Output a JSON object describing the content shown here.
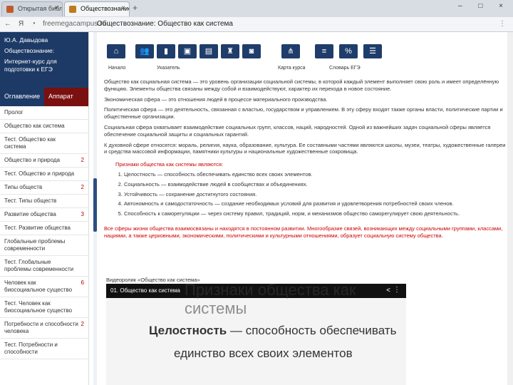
{
  "browser": {
    "tabs": [
      {
        "label": "Открытая библ"
      },
      {
        "label": "Обществознание"
      }
    ],
    "url": "freemegacampus.ru",
    "page_title": "Обществознание: Общество как система",
    "new_tab": "+",
    "window_buttons": "– □ ×"
  },
  "sidebar": {
    "author": "Ю.А. Давыдова",
    "course": "Обществознание:",
    "subtitle": "Интернет-курс для подготовки к ЕГЭ",
    "tabs": [
      {
        "label": "Оглавление"
      },
      {
        "label": "Аппарат"
      }
    ],
    "items": [
      {
        "label": "Пролог",
        "count": ""
      },
      {
        "label": "Общество как система",
        "count": ""
      },
      {
        "label": "Тест. Общество как система",
        "count": ""
      },
      {
        "label": "Общество и природа",
        "count": "2"
      },
      {
        "label": "Тест. Общество и природа",
        "count": ""
      },
      {
        "label": "Типы обществ",
        "count": "2"
      },
      {
        "label": "Тест. Типы обществ",
        "count": ""
      },
      {
        "label": "Развитие общества",
        "count": "3"
      },
      {
        "label": "Тест. Развитие общества",
        "count": ""
      },
      {
        "label": "Глобальные проблемы современности",
        "count": ""
      },
      {
        "label": "Тест. Глобальные проблемы современности",
        "count": ""
      },
      {
        "label": "Человек как биосоциальное существо",
        "count": "6"
      },
      {
        "label": "Тест. Человек как биосоциальное существо",
        "count": ""
      },
      {
        "label": "Потребности и способности человека",
        "count": "2"
      },
      {
        "label": "Тест. Потребности и способности",
        "count": ""
      }
    ]
  },
  "toolbar": {
    "buttons": [
      {
        "icon": "home-icon",
        "glyph": "⌂"
      },
      {
        "icon": "users-icon",
        "glyph": "👥"
      },
      {
        "icon": "book-icon",
        "glyph": "▮"
      },
      {
        "icon": "briefcase-icon",
        "glyph": "▣"
      },
      {
        "icon": "folder-icon",
        "glyph": "▤"
      },
      {
        "icon": "tool-icon",
        "glyph": "♜"
      },
      {
        "icon": "camera-icon",
        "glyph": "◙"
      },
      {
        "icon": "hierarchy-icon",
        "glyph": "⋔"
      },
      {
        "icon": "tree-icon",
        "glyph": "≡"
      },
      {
        "icon": "percent-icon",
        "glyph": "%"
      },
      {
        "icon": "list-icon",
        "glyph": "☰"
      }
    ],
    "labels": [
      "Начало",
      "Указатель",
      "Карта курса",
      "Словарь ЕГЭ"
    ]
  },
  "content": {
    "p1": "Общество как социальная система — это уровень организации социальной системы, в которой каждый элемент выполняет свою роль и имеет определённую функцию. Элементы общества связаны между собой и взаимодействуют, характер их перехода в новое состояние.",
    "p2": "Экономическая сфера — это отношения людей в процессе материального производства.",
    "p3": "Политическая сфера — это деятельность, связанная с властью, государством и управлением. В эту сферу входят также органы власти, политические партии и общественные организации.",
    "p4": "Социальная сфера охватывает взаимодействие социальных групп, классов, наций, народностей. Одной из важнейших задач социальной сферы является обеспечение социальной защиты и социальных гарантий.",
    "p5": "К духовной сфере относятся: мораль, религия, наука, образование, культура. Ее составными частями являются школы, музеи, театры, художественные галереи и средства массовой информации, памятники культуры и национальные художественные сокровища.",
    "box_head": "Признаки общества как системы являются:",
    "box_items": [
      "Целостность — способность обеспечивать единство всех своих элементов.",
      "Социальность — взаимодействие людей в сообществах и объединениях.",
      "Устойчивость — сохранение достигнутого состояния.",
      "Автономность и самодостаточность — создание необходимых условий для развития и удовлетворения потребностей своих членов.",
      "Способность к саморегуляции — через систему правил, традиций, норм, и механизмов общество саморегулирует свою деятельность."
    ],
    "p6": "Все сферы жизни общества взаимосвязаны и находятся в постоянном развитии. Многообразие связей, возникающих между социальными группами, классами, нациями, а также церковными, экономическими, политическими и культурными отношениями, образует социальную систему общества."
  },
  "video": {
    "caption": "Видеоролик «Общество как система»",
    "title": "01. Общество как система",
    "ghost": "Признаки общества как системы",
    "line1_bold": "Целостность",
    "line1_rest": " — способность обеспечивать",
    "line2": "единство всех своих элементов"
  },
  "colors": {
    "navy": "#1d3a66",
    "maroon": "#7a1010",
    "accent_red": "#c00000"
  }
}
